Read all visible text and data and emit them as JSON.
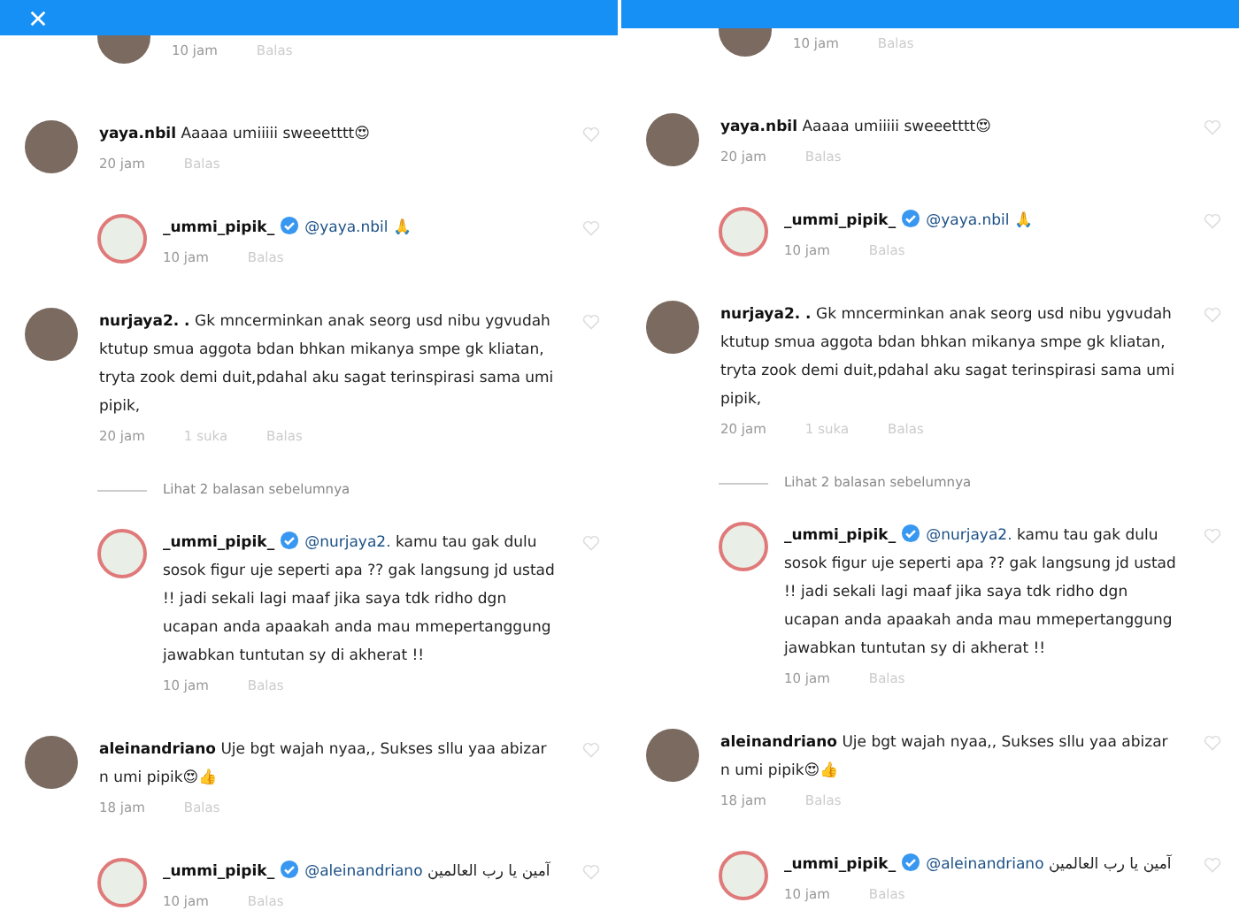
{
  "panels": [
    {
      "items": [
        {
          "kind": "tail",
          "time": "10 jam",
          "reply_label": "Balas"
        },
        {
          "kind": "comment",
          "username": "yaya.nbil",
          "text": "Aaaaa umiiiii sweeetttt😍",
          "time": "20 jam",
          "reply_label": "Balas"
        },
        {
          "kind": "reply",
          "username": "_ummi_pipik_",
          "verified": true,
          "mention": "@yaya.nbil",
          "text": "🙏",
          "time": "10 jam",
          "reply_label": "Balas"
        },
        {
          "kind": "comment",
          "username": "nurjaya2. .",
          "text": "Gk mncerminkan anak seorg usd nibu ygvudah ktutup smua aggota bdan bhkan mikanya smpe gk kliatan, tryta zook demi duit,pdahal aku sagat terinspirasi sama umi pipik,",
          "time": "20 jam",
          "likes": "1 suka",
          "reply_label": "Balas"
        },
        {
          "kind": "more",
          "label": "Lihat 2 balasan sebelumnya"
        },
        {
          "kind": "reply",
          "username": "_ummi_pipik_",
          "verified": true,
          "mention": "@nurjaya2.",
          "text": "kamu tau gak dulu sosok figur uje seperti apa ?? gak langsung jd ustad !! jadi sekali lagi maaf jika saya tdk ridho dgn ucapan anda apaakah anda mau mmepertanggung jawabkan tuntutan sy di akherat !!",
          "time": "10 jam",
          "reply_label": "Balas"
        },
        {
          "kind": "comment",
          "username": "aleinandriano",
          "text": "Uje bgt wajah nyaa,, Sukses sllu yaa abizar n umi pipik😍👍",
          "time": "18 jam",
          "reply_label": "Balas"
        },
        {
          "kind": "reply",
          "username": "_ummi_pipik_",
          "verified": true,
          "mention": "@aleinandriano",
          "text": "آمين يا رب العالمين",
          "time": "10 jam",
          "reply_label": "Balas"
        }
      ]
    },
    {
      "items": [
        {
          "kind": "tail",
          "time": "10 jam",
          "reply_label": "Balas"
        },
        {
          "kind": "comment",
          "username": "yaya.nbil",
          "text": "Aaaaa umiiiii sweeetttt😍",
          "time": "20 jam",
          "reply_label": "Balas"
        },
        {
          "kind": "reply",
          "username": "_ummi_pipik_",
          "verified": true,
          "mention": "@yaya.nbil",
          "text": "🙏",
          "time": "10 jam",
          "reply_label": "Balas"
        },
        {
          "kind": "comment",
          "username": "nurjaya2. .",
          "text": "Gk mncerminkan anak seorg usd nibu ygvudah ktutup smua aggota bdan bhkan mikanya smpe gk kliatan, tryta zook demi duit,pdahal aku sagat terinspirasi sama umi pipik,",
          "time": "20 jam",
          "likes": "1 suka",
          "reply_label": "Balas"
        },
        {
          "kind": "more",
          "label": "Lihat 2 balasan sebelumnya"
        },
        {
          "kind": "reply",
          "username": "_ummi_pipik_",
          "verified": true,
          "mention": "@nurjaya2.",
          "text": "kamu tau gak dulu sosok figur uje seperti apa ?? gak langsung jd ustad !! jadi sekali lagi maaf jika saya tdk ridho dgn ucapan anda apaakah anda mau mmepertanggung jawabkan tuntutan sy di akherat !!",
          "time": "10 jam",
          "reply_label": "Balas"
        },
        {
          "kind": "comment",
          "username": "aleinandriano",
          "text": "Uje bgt wajah nyaa,, Sukses sllu yaa abizar n umi pipik😍👍",
          "time": "18 jam",
          "reply_label": "Balas"
        },
        {
          "kind": "reply",
          "username": "_ummi_pipik_",
          "verified": true,
          "mention": "@aleinandriano",
          "text": "آمين يا رب العالمين",
          "time": "10 jam",
          "reply_label": "Balas"
        }
      ]
    }
  ]
}
